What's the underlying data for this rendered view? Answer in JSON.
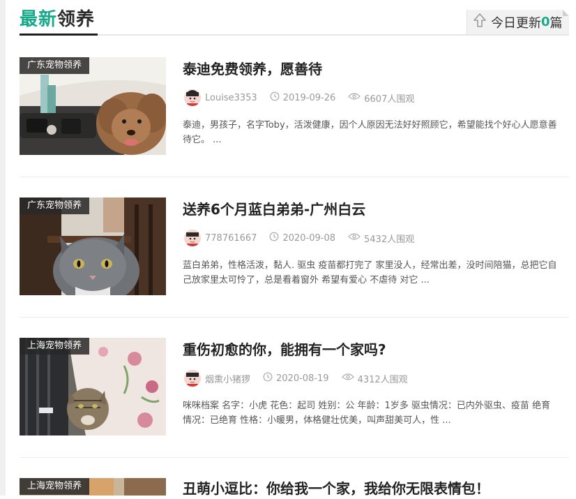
{
  "section": {
    "title_highlight": "最新",
    "title_rest": "领养",
    "update_prefix": "今日更新",
    "update_count": "0",
    "update_suffix": "篇"
  },
  "icons": {
    "update": "arrow-up-icon",
    "avatar": "avatar-icon",
    "date": "clock-icon",
    "views": "eye-icon"
  },
  "colors": {
    "accent": "#18a88a",
    "tag_bg": "#282828",
    "meta_text": "#999999"
  },
  "posts": [
    {
      "tag": "广东宠物领养",
      "title": "泰迪免费领养，愿善待",
      "author": "Louise3353",
      "date": "2019-09-26",
      "views": "6607人围观",
      "excerpt": "泰迪，男孩子，名字Toby，活泼健康，因个人原因无法好好照顾它，希望能找个好心人愿意善待它。 ..."
    },
    {
      "tag": "广东宠物领养",
      "title": "送养6个月蓝白弟弟-广州白云",
      "author": "778761667",
      "date": "2020-09-08",
      "views": "5432人围观",
      "excerpt": "蓝白弟弟，性格活泼，黏人. 驱虫 疫苗都打完了 家里没人，经常出差，没时间陪猫，总把它自己放家里太可怜了，总是看着窗外 希望有爱心 不虐待 对它 ..."
    },
    {
      "tag": "上海宠物领养",
      "title": "重伤初愈的你，能拥有一个家吗?",
      "author": "烟熏小猪猡",
      "date": "2020-08-19",
      "views": "4312人围观",
      "excerpt": "咪咪档案 名字：小虎 花色：起司 姓别：公 年龄：1岁多 驱虫情况：已内外驱虫、疫苗 绝育情况：已绝育 性格：小暖男，体格健壮优美，叫声甜美可人，性 ..."
    },
    {
      "tag": "上海宠物领养",
      "title": "丑萌小逗比：你给我一个家，我给你无限表情包！"
    }
  ]
}
